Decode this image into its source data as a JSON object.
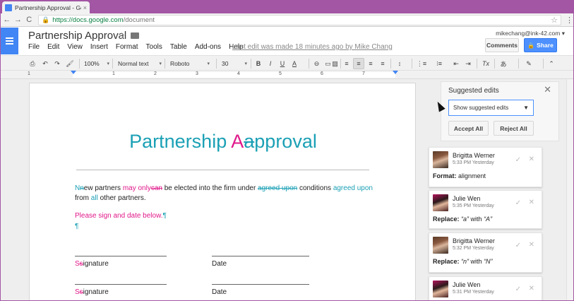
{
  "browser": {
    "tab_title": "Partnership Approval - Google",
    "tab_close": "×",
    "back": "←",
    "forward": "→",
    "reload": "C",
    "lock": "🔒",
    "url_domain": "https://docs.google.com",
    "url_path": "/document",
    "star": "☆",
    "menu": "⋮"
  },
  "docs": {
    "title": "Partnership Approval",
    "title_star": "☆",
    "menu": [
      "File",
      "Edit",
      "View",
      "Insert",
      "Format",
      "Tools",
      "Table",
      "Add-ons",
      "Help"
    ],
    "last_edit": "Last edit was made 18 minutes ago by Mike Chang",
    "user_email": "mikechang@ink-42.com ▾",
    "comments_label": "Comments",
    "share_label": "Share",
    "share_icon": "🔒"
  },
  "toolbar": {
    "print": "⎙",
    "undo": "↶",
    "redo": "↷",
    "paint": "🖌",
    "zoom": "100%",
    "style": "Normal text",
    "font": "Roboto",
    "size": "30",
    "bold": "B",
    "italic": "I",
    "underline": "U",
    "textcolor": "A",
    "link": "⊖",
    "comment": "▭",
    "image": "▨",
    "align_left": "≡",
    "align_center": "≡",
    "align_right": "≡",
    "align_justify": "≡",
    "linespacing": "↕",
    "numbered": "⋮≡",
    "bulleted": "⁝≡",
    "decrease_indent": "⇤",
    "increase_indent": "⇥",
    "clear": "Tx",
    "input_tools": "あ",
    "pen": "✎",
    "collapse": "⌃",
    "caret": "▾"
  },
  "ruler": {
    "numbers": [
      "1",
      "1",
      "2",
      "3",
      "4",
      "5",
      "6",
      "7"
    ]
  },
  "document": {
    "heading_before": "Partnership ",
    "heading_ins": "A",
    "heading_del": "a",
    "heading_after": "pproval",
    "p1_ins_N": "N",
    "p1_del_n": "n",
    "p1_a": "ew partners ",
    "p1_ins_may_only": "may only",
    "p1_del_can": "can",
    "p1_b": " be elected into the firm under ",
    "p1_del_agreed": "agreed upon",
    "p1_c": " conditions ",
    "p1_ins_agreed": "agreed upon",
    "p1_d": "from ",
    "p1_ins_all": "all",
    "p1_e": " other partners.",
    "p2": "Please sign and date below.",
    "pilcrow": "¶",
    "sig_ins_S": "S",
    "sig_del_s": "s",
    "sig_rest": "ignature",
    "date_label": "Date"
  },
  "suggested_edits": {
    "title": "Suggested edits",
    "close": "✕",
    "select_value": "Show suggested edits",
    "select_caret": "▼",
    "accept_all": "Accept All",
    "reject_all": "Reject All"
  },
  "suggestions": [
    {
      "name": "Brigitta Werner",
      "time": "5:33 PM Yesterday",
      "label": "Format:",
      "text_a": " alignment",
      "q1": "",
      "text_b": "",
      "q2": ""
    },
    {
      "name": "Julie Wen",
      "time": "5:35 PM Yesterday",
      "label": "Replace:",
      "text_a": " ",
      "q1": "“a”",
      "text_b": " with ",
      "q2": "“A”"
    },
    {
      "name": "Brigitta Werner",
      "time": "5:32 PM Yesterday",
      "label": "Replace:",
      "text_a": " ",
      "q1": "“n”",
      "text_b": " with ",
      "q2": "“N”"
    },
    {
      "name": "Julie Wen",
      "time": "5:31 PM Yesterday",
      "label": "",
      "text_a": "",
      "q1": "",
      "text_b": "",
      "q2": ""
    }
  ],
  "card_accept": "✓",
  "card_reject": "✕",
  "colors": {
    "insert": "#e0188a",
    "teal": "#1ba0b5",
    "share": "#4d90fe",
    "docs_blue": "#4285f4",
    "frame": "#a356a3"
  }
}
